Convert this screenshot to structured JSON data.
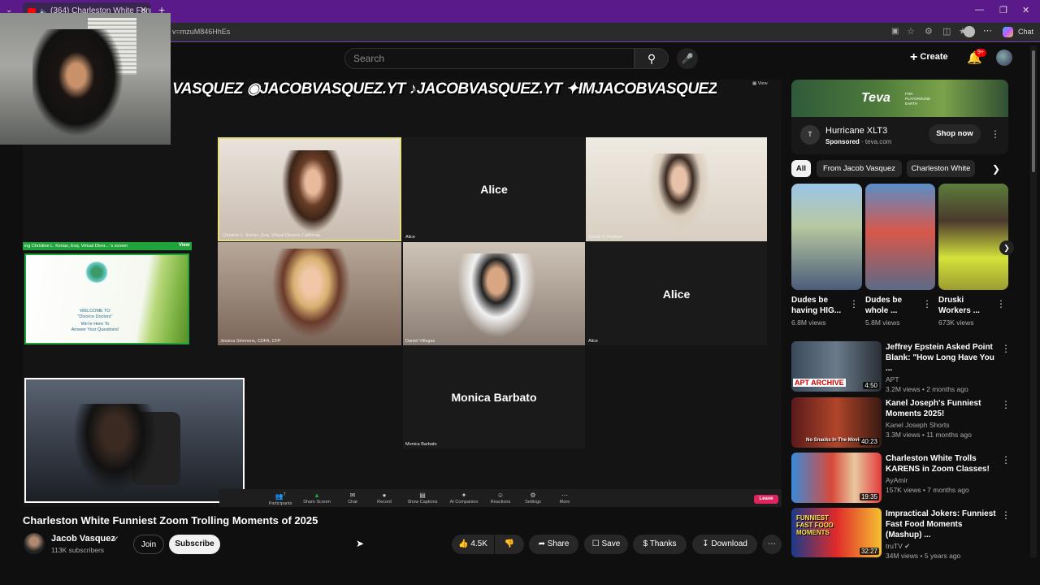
{
  "browser": {
    "tab_title": "(364) Charleston White Funni",
    "url": "v=mzuM846HhEs",
    "chat_label": "Chat"
  },
  "header": {
    "search_placeholder": "Search",
    "create_label": "Create",
    "notif_count": "9+"
  },
  "video": {
    "banner": "VASQUEZ ◉JACOBVASQUEZ.YT ♪JACOBVASQUEZ.YT ✦IMJACOBVASQUEZ",
    "share_bar": "ing  Christine L. Kerian, Esq. Virtual Divor... 's screen",
    "share_view": "View",
    "slide_line1": "WELCOME TO",
    "slide_line2": "\"Divorce Doctors\"",
    "slide_line3": "We're Here To",
    "slide_line4": "Answer Your Questions!",
    "tiles": [
      {
        "label": "Christine L. Kerian, Esq. Virtual Divorce California",
        "name": ""
      },
      {
        "label": "Alice",
        "name": "Alice"
      },
      {
        "label": "Sandy P. Pedram",
        "name": ""
      },
      {
        "label": "Jessica Simmons, CDFA, CFP",
        "name": ""
      },
      {
        "label": "Daniel Villegas",
        "name": ""
      },
      {
        "label": "Alice",
        "name": "Alice"
      },
      {
        "label": "Monica Barbato",
        "name": "Monica Barbato"
      }
    ],
    "zoom_buttons": [
      "Participants",
      "Share Screen",
      "Chat",
      "Record",
      "Show Captions",
      "AI Companion",
      "Reactions",
      "Settings",
      "More"
    ],
    "participants_count": "7",
    "leave_label": "Leave",
    "view_label": "View",
    "title": "Charleston White Funniest Zoom Trolling Moments of 2025"
  },
  "channel": {
    "name": "Jacob Vasquez",
    "subs": "113K subscribers",
    "join": "Join",
    "subscribe": "Subscribe"
  },
  "actions": {
    "likes": "4.5K",
    "share": "Share",
    "save": "Save",
    "thanks": "Thanks",
    "download": "Download"
  },
  "ad": {
    "brand": "Teva",
    "tagline": "FOR PLAYGROUND EARTH",
    "title": "Hurricane XLT3",
    "sponsored": "Sponsored",
    "domain": "teva.com",
    "cta": "Shop now"
  },
  "chips": [
    "All",
    "From Jacob Vasquez",
    "Charleston White"
  ],
  "shorts": [
    {
      "title": "Dudes be having HIG...",
      "views": "6.8M views"
    },
    {
      "title": "Dudes be whole ...",
      "views": "5.8M views"
    },
    {
      "title": "Druski Workers ...",
      "views": "673K views"
    }
  ],
  "related": [
    {
      "title1": "Jeffrey Epstein Asked Point",
      "title2": "Blank: \"How Long Have You ...",
      "channel": "APT",
      "meta": "3.2M views • 2 months ago",
      "duration": "4:50",
      "thumb_text": "APT ARCHIVE"
    },
    {
      "title1": "Kanel Joseph's Funniest",
      "title2": "Moments 2025!",
      "channel": "Kanel Joseph Shorts",
      "meta": "3.3M views • 11 months ago",
      "duration": "40:23",
      "thumb_text": "No Snacks In The Movie"
    },
    {
      "title1": "Charleston White Trolls",
      "title2": "KARENS in Zoom Classes!",
      "channel": "AyAmir",
      "meta": "157K views • 7 months ago",
      "duration": "19:35",
      "thumb_text": ""
    },
    {
      "title1": "Impractical Jokers: Funniest",
      "title2": "Fast Food Moments (Mashup) ...",
      "channel": "truTV",
      "meta": "34M views • 5 years ago",
      "duration": "32:27",
      "thumb_text": "FUNNIEST FAST FOOD MOMENTS"
    }
  ]
}
